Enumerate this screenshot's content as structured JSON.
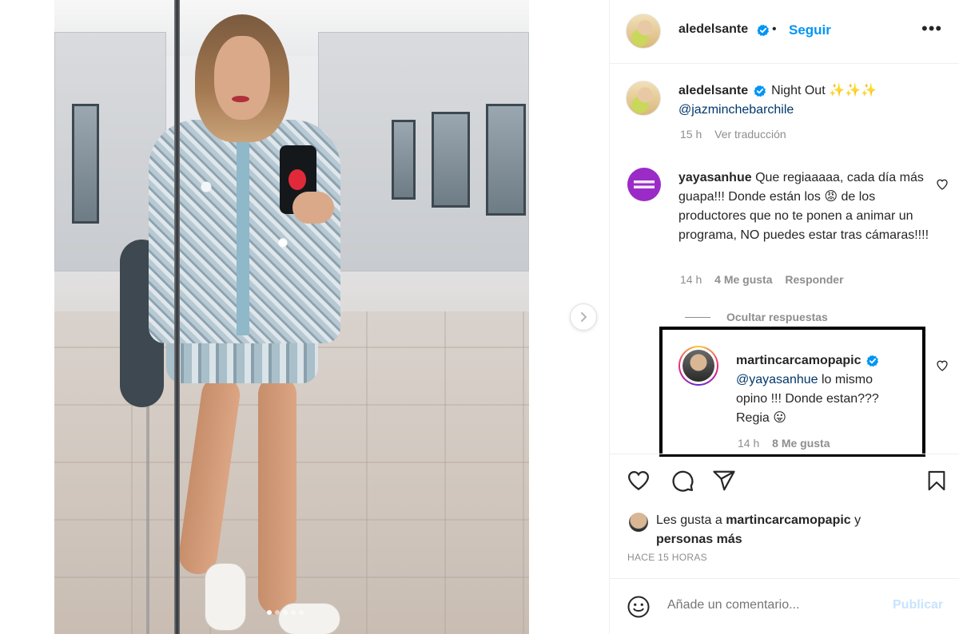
{
  "post": {
    "author": "aledelsante",
    "follow_label": "Seguir",
    "more_label": "•••",
    "bullet": "•",
    "photo_dot_count": 5
  },
  "caption": {
    "username": "aledelsante",
    "text": "Night Out ✨✨✨",
    "mention": "@jazminchebarchile",
    "time": "15 h",
    "translate": "Ver traducción"
  },
  "comment1": {
    "username": "yayasanhue",
    "text_a": "Que regiaaaaa, cada día más guapa!!! Donde están los",
    "emoji": "😡",
    "text_b": "de los productores que no te ponen a animar un programa, NO puedes estar tras cámaras!!!!",
    "time": "14 h",
    "likes": "4 Me gusta",
    "reply": "Responder",
    "hide_replies": "Ocultar respuestas"
  },
  "reply1": {
    "username": "martincarcamopapic",
    "mention": "@yayasanhue",
    "text": "lo mismo opino !!! Donde estan??? Regia",
    "emoji": "😛",
    "time": "14 h",
    "likes": "8 Me gusta"
  },
  "likes": {
    "prefix": "Les gusta a",
    "user": "martincarcamopapic",
    "suffix": "y",
    "others": "personas más",
    "date": "HACE 15 HORAS"
  },
  "add_comment": {
    "placeholder": "Añade un comentario...",
    "publish": "Publicar"
  },
  "icons": {
    "heart": "heart-icon",
    "comment": "comment-icon",
    "share": "share-icon",
    "bookmark": "bookmark-icon",
    "emoji": "emoji-icon",
    "next": "chevron-right-icon",
    "verified": "verified-badge-icon"
  },
  "colors": {
    "link_blue": "#0095f6",
    "mention_blue": "#00376b",
    "verified_blue": "#0095f6",
    "muted": "#8e8e8e",
    "publish_disabled": "#c7e4fc"
  }
}
